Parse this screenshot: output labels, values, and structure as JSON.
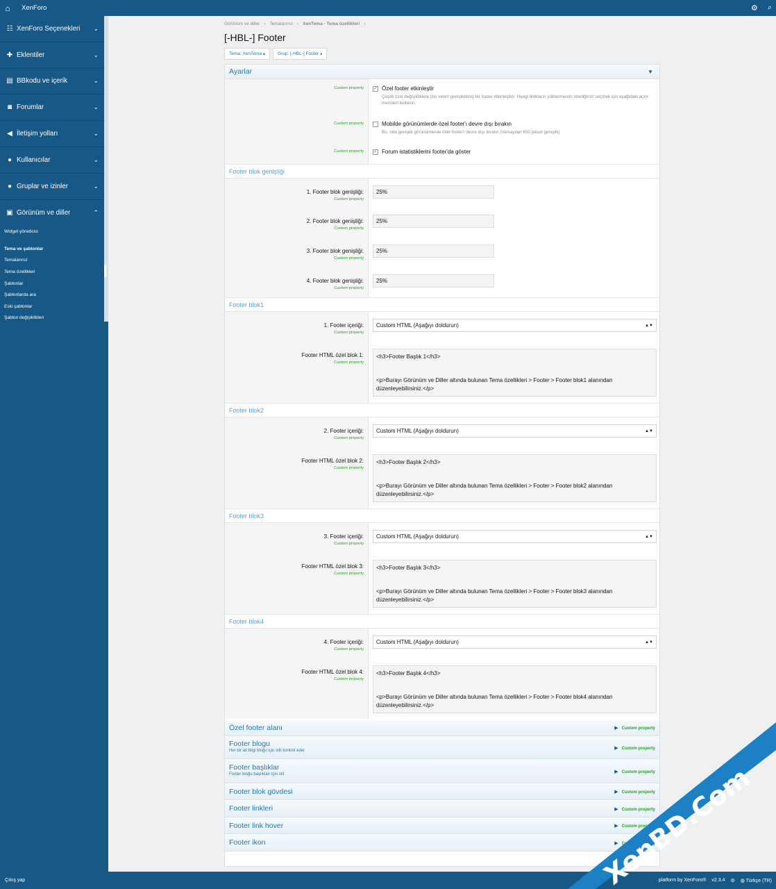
{
  "topbar": {
    "brand": "XenForo"
  },
  "sidebar": {
    "items": [
      {
        "label": "XenForo Seçenekleri",
        "icon": "sliders-icon",
        "glyph": "☷"
      },
      {
        "label": "Eklentiler",
        "icon": "puzzle-icon",
        "glyph": "✚"
      },
      {
        "label": "BBkodu ve içerik",
        "icon": "keyboard-icon",
        "glyph": "▤"
      },
      {
        "label": "Forumlar",
        "icon": "comments-icon",
        "glyph": "◙"
      },
      {
        "label": "İletişim yolları",
        "icon": "bullhorn-icon",
        "glyph": "◀"
      },
      {
        "label": "Kullanıcılar",
        "icon": "user-icon",
        "glyph": "●"
      },
      {
        "label": "Gruplar ve izinler",
        "icon": "users-icon",
        "glyph": "●"
      },
      {
        "label": "Görünüm ve diller",
        "icon": "image-icon",
        "glyph": "▣"
      }
    ],
    "sub": {
      "widget": "Widget yöneticisi",
      "group_head": "Tema ve şablonlar",
      "links": [
        "Temalarınız",
        "Tema özellikleri",
        "Şablonlar",
        "Şablonlarda ara",
        "Eski şablonlar",
        "Şablon değişiklikleri"
      ]
    }
  },
  "breadcrumb": [
    "Görünüm ve diller",
    "Temalarınız",
    "XenTema - Tema özellikleri"
  ],
  "page_title": "[-HBL-] Footer",
  "filters": {
    "theme": "Tema: XenTema",
    "group": "Grup: [-HBL-] Footer"
  },
  "settings": {
    "title": "Ayarlar",
    "custom_property": "Custom property",
    "opt1_label": "Özel footer etkinleştir",
    "opt1_desc": "Çeşitli özel değişikliklere izin veren genişletilmiş bir footer etkinleştirir. Hangi blokların yüklenmesini istediğinizi seçmek için aşağıdaki açılır menüleri kullanın.",
    "opt2_label": "Mobilde görünümlerde özel footer'ı devre dışı bırakın",
    "opt2_desc": "Bu, orta genişlik görünümlerde özel footer'ı devre dışı bırakır (Varsayılan 650 piksel genişlik)",
    "opt3_label": "Forum istatistiklerini footer'da göster"
  },
  "width_section": {
    "title": "Footer blok genişliği",
    "rows": [
      {
        "label": "1. Footer blok genişliği:",
        "value": "25%"
      },
      {
        "label": "2. Footer blok genişliği:",
        "value": "25%"
      },
      {
        "label": "3. Footer blok genişliği:",
        "value": "25%"
      },
      {
        "label": "4. Footer blok genişliği:",
        "value": "25%"
      }
    ]
  },
  "blocks": [
    {
      "title": "Footer blok1",
      "content_label": "1. Footer içeriği:",
      "select": "Custom HTML (Aşağıyı doldurun)",
      "html_label": "Footer HTML özel blok 1:",
      "line1": "<h3>Footer Başlık 1</h3>",
      "line2": "<p>Burayı Görünüm ve Diller altında bulunan Tema özellikleri > Footer > Footer blok1 alanından",
      "line3": "düzenleyebilirsiniz.</p>"
    },
    {
      "title": "Footer blok2",
      "content_label": "2. Footer içeriği:",
      "select": "Custom HTML (Aşağıyı doldurun)",
      "html_label": "Footer HTML özel blok 2:",
      "line1": "<h3>Footer Başlık 2</h3>",
      "line2": "<p>Burayı Görünüm ve Diller altında bulunan Tema özellikleri > Footer > Footer blok2 alanından",
      "line3": "düzenleyebilirsiniz.</p>"
    },
    {
      "title": "Footer blok3",
      "content_label": "3. Footer içeriği:",
      "select": "Custom HTML (Aşağıyı doldurun)",
      "html_label": "Footer HTML özel blok 3:",
      "line1": "<h3>Footer Başlık 3</h3>",
      "line2": "<p>Burayı Görünüm ve Diller altında bulunan Tema özellikleri > Footer > Footer blok3 alanından",
      "line3": "düzenleyebilirsiniz.</p>"
    },
    {
      "title": "Footer blok4",
      "content_label": "4. Footer içeriği:",
      "select": "Custom HTML (Aşağıyı doldurun)",
      "html_label": "Footer HTML özel blok 4:",
      "line1": "<h3>Footer Başlık 4</h3>",
      "line2": "<p>Burayı Görünüm ve Diller altında bulunan Tema özellikleri > Footer > Footer blok4 alanından",
      "line3": "düzenleyebilirsiniz.</p>"
    }
  ],
  "collapsed": [
    {
      "title": "Özel footer alanı",
      "desc": ""
    },
    {
      "title": "Footer blogu",
      "desc": "Her bir alt bilgi bloğu için stili kontrol eder"
    },
    {
      "title": "Footer başlıklar",
      "desc": "Footer bloğu başlıkları için stil"
    },
    {
      "title": "Footer blok gövdesi",
      "desc": ""
    },
    {
      "title": "Footer linkleri",
      "desc": ""
    },
    {
      "title": "Footer link hover",
      "desc": ""
    },
    {
      "title": "Footer ikon",
      "desc": ""
    }
  ],
  "bottombar": {
    "logout": "Çıkış yap",
    "platform": "platform by XenForo®",
    "version": "v2.3.4",
    "language": "Türkçe (TR)"
  },
  "watermark": "XenBD.Com",
  "colors": {
    "brand": "#185886",
    "link": "#2577b1",
    "hint": "#2b9a2b"
  }
}
